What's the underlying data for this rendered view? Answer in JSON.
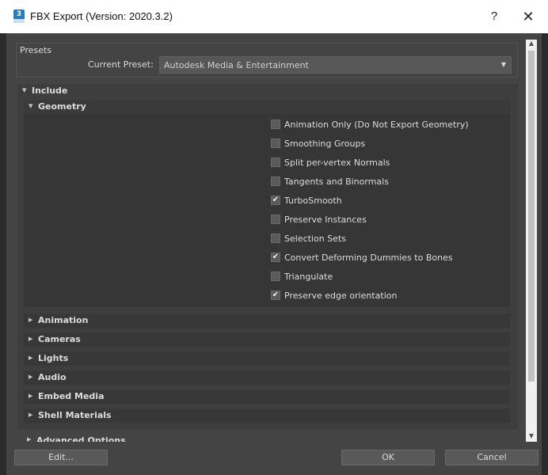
{
  "window": {
    "title": "FBX Export (Version: 2020.3.2)",
    "app_icon_text": "3",
    "help": "?",
    "close": "✕"
  },
  "presets": {
    "section_label": "Presets",
    "current_preset_label": "Current Preset:",
    "current_preset_value": "Autodesk Media & Entertainment",
    "dropdown_arrow": "▼"
  },
  "include": {
    "label": "Include",
    "expanded_arrow": "▼",
    "geometry": {
      "label": "Geometry",
      "options": [
        {
          "label": "Animation Only (Do Not Export Geometry)",
          "checked": false
        },
        {
          "label": "Smoothing Groups",
          "checked": false
        },
        {
          "label": "Split per-vertex Normals",
          "checked": false
        },
        {
          "label": "Tangents and Binormals",
          "checked": false
        },
        {
          "label": "TurboSmooth",
          "checked": true
        },
        {
          "label": "Preserve Instances",
          "checked": false
        },
        {
          "label": "Selection Sets",
          "checked": false
        },
        {
          "label": "Convert Deforming Dummies to Bones",
          "checked": true
        },
        {
          "label": "Triangulate",
          "checked": false
        },
        {
          "label": "Preserve edge orientation",
          "checked": true
        }
      ]
    },
    "collapsed_arrow": "▶",
    "sections": [
      "Animation",
      "Cameras",
      "Lights",
      "Audio",
      "Embed Media",
      "Shell Materials"
    ]
  },
  "advanced": {
    "label": "Advanced Options"
  },
  "buttons": {
    "edit": "Edit...",
    "ok": "OK",
    "cancel": "Cancel"
  },
  "scrollbar": {
    "up": "▲",
    "down": "▼"
  }
}
